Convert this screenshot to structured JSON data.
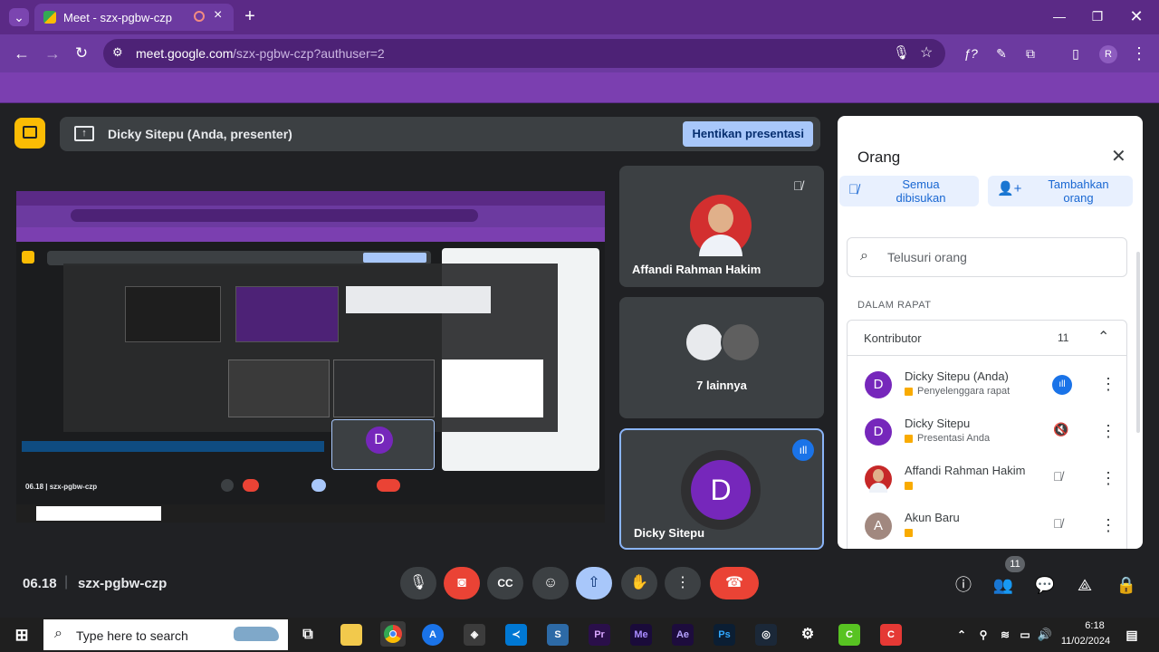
{
  "browser": {
    "tab_title": "Meet - szx-pgbw-czp",
    "url_host": "meet.google.com",
    "url_path": "/szx-pgbw-czp?authuser=2",
    "profile_initial": "R"
  },
  "meet": {
    "banner_text": "Dicky Sitepu (Anda, presenter)",
    "stop_presenting": "Hentikan presentasi",
    "tiles": [
      {
        "name": "Affandi Rahman Hakim"
      },
      {
        "name": "7 lainnya"
      },
      {
        "name": "Dicky Sitepu",
        "initial": "D"
      }
    ],
    "meeting_time": "06.18",
    "meeting_code": "szx-pgbw-czp",
    "participant_count": "11"
  },
  "people_panel": {
    "title": "Orang",
    "mute_all": "Semua dibisukan",
    "add_people": "Tambahkan orang",
    "search_placeholder": "Telusuri orang",
    "section_label": "DALAM RAPAT",
    "group_label": "Kontributor",
    "group_count": "11",
    "participants": [
      {
        "initial": "D",
        "name": "Dicky Sitepu (Anda)",
        "role": "Penyelenggara rapat",
        "avatar_color": "#7627bb"
      },
      {
        "initial": "D",
        "name": "Dicky Sitepu",
        "role": "Presentasi Anda",
        "avatar_color": "#7627bb"
      },
      {
        "initial": "",
        "name": "Affandi Rahman Hakim",
        "role": "",
        "avatar_color": "#c62828"
      },
      {
        "initial": "A",
        "name": "Akun Baru",
        "role": "",
        "avatar_color": "#a1887f"
      }
    ]
  },
  "taskbar": {
    "search_placeholder": "Type here to search",
    "time": "6:18",
    "date": "11/02/2024",
    "apps": [
      "Pr",
      "Me",
      "Ae",
      "Ps"
    ]
  },
  "colors": {
    "brand_purple": "#6c3aa0",
    "meet_dark": "#202124",
    "end_call_red": "#ea4335",
    "active_blue": "#a8c7fa"
  }
}
